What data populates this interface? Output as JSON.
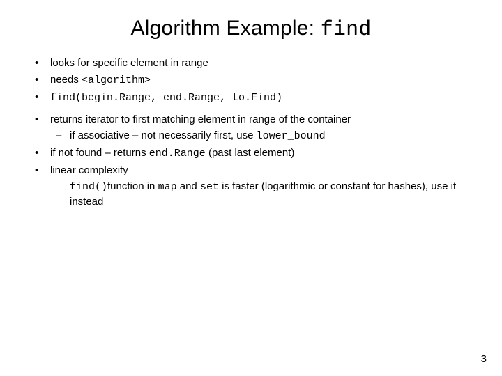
{
  "title_prefix": "Algorithm Example: ",
  "title_code": "find",
  "bullets": {
    "b1": "looks for specific element in range",
    "b2_pre": "needs ",
    "b2_code": "<algorithm>",
    "b3_code": "find(begin.Range, end.Range, to.Find)",
    "b4": "returns iterator to first matching element in range of the container",
    "b4_sub_pre": "if associative – not necessarily first, use ",
    "b4_sub_code": "lower_bound",
    "b5_pre": "if not found – returns ",
    "b5_code": "end.Range",
    "b5_post": " (past last element)",
    "b6": "linear complexity",
    "b6_cont_code": "find()",
    "b6_cont_mid": "function  in ",
    "b6_cont_map": "map",
    "b6_cont_and": " and ",
    "b6_cont_set": "set",
    "b6_cont_tail": " is faster (logarithmic or constant for hashes), use it instead"
  },
  "page_number": "3"
}
